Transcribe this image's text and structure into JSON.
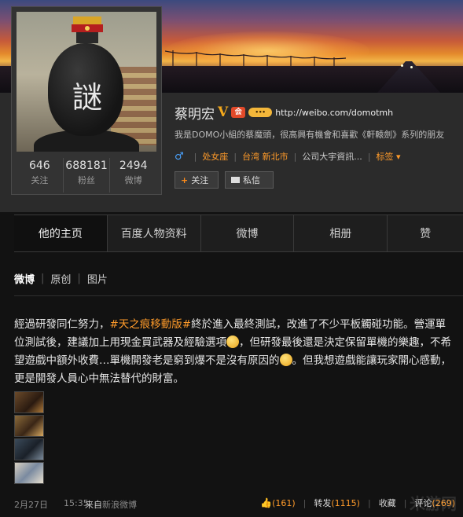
{
  "profile": {
    "name": "蔡明宏",
    "verified_mark": "V",
    "url": "http://weibo.com/domotmh",
    "avatar_glyph": "謎",
    "bio": "我是DOMO小組的蔡魔頭，很高興有機會和喜歡《軒轅劍》系列的朋友",
    "gender": "♂",
    "constellation": "处女座",
    "location": "台湾 新北市",
    "company": "公司大宇資訊...",
    "tags_label": "标签",
    "stats": [
      {
        "value": "646",
        "label": "关注"
      },
      {
        "value": "688181",
        "label": "粉丝"
      },
      {
        "value": "2494",
        "label": "微博"
      }
    ],
    "follow_label": "关注",
    "message_label": "私信"
  },
  "tabs": [
    {
      "label": "他的主页",
      "active": true
    },
    {
      "label": "百度人物资料",
      "active": false
    },
    {
      "label": "微博",
      "active": false
    },
    {
      "label": "相册",
      "active": false
    },
    {
      "label": "赞",
      "active": false
    }
  ],
  "subnav": {
    "items": [
      "微博",
      "原创",
      "图片"
    ]
  },
  "post": {
    "part1": "經過研發同仁努力，",
    "hashtag": "#天之痕移動版#",
    "part2": "終於進入最終測試，改進了不少平板觸碰功能。營運單位測試後，建議加上用現金買武器及經驗選項",
    "part3": "，但研發最後還是決定保留單機的樂趣，不希望遊戲中額外收費…單機開發老是窮到爆不是沒有原因的",
    "part4": "。但我想遊戲能讓玩家開心感動，更是開發人員心中無法替代的財富。",
    "date": "2月27日",
    "time": "15:35",
    "from_label": "来自",
    "source": "新浪微博",
    "likes": "(161)",
    "repost_label": "转发",
    "reposts": "(1115)",
    "fav_label": "收藏",
    "comment_label": "评论",
    "comments": "(269)"
  },
  "watermark": "米游网"
}
